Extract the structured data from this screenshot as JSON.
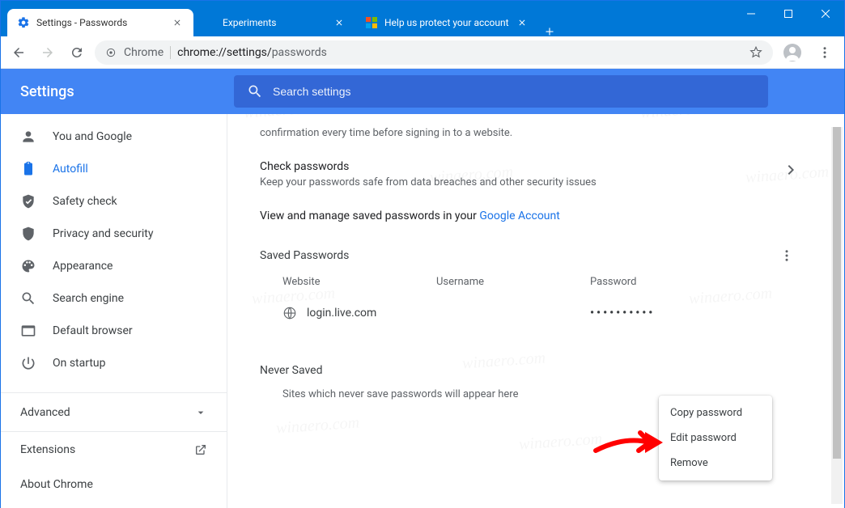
{
  "window": {
    "tabs": [
      {
        "title": "Settings - Passwords",
        "active": true
      },
      {
        "title": "Experiments",
        "active": false
      },
      {
        "title": "Help us protect your account",
        "active": false
      }
    ]
  },
  "omnibox": {
    "origin_label": "Chrome",
    "url_host": "chrome://settings/",
    "url_path": "passwords"
  },
  "header": {
    "brand": "Settings",
    "search_placeholder": "Search settings"
  },
  "sidebar": {
    "items": [
      {
        "label": "You and Google"
      },
      {
        "label": "Autofill"
      },
      {
        "label": "Safety check"
      },
      {
        "label": "Privacy and security"
      },
      {
        "label": "Appearance"
      },
      {
        "label": "Search engine"
      },
      {
        "label": "Default browser"
      },
      {
        "label": "On startup"
      }
    ],
    "advanced": "Advanced",
    "extensions": "Extensions",
    "about": "About Chrome"
  },
  "main": {
    "fingerprint_sub": "confirmation every time before signing in to a website.",
    "check": {
      "title": "Check passwords",
      "sub": "Keep your passwords safe from data breaches and other security issues"
    },
    "manage_prefix": "View and manage saved passwords in your ",
    "manage_link": "Google Account",
    "saved_title": "Saved Passwords",
    "cols": {
      "website": "Website",
      "username": "Username",
      "password": "Password"
    },
    "row": {
      "site": "login.live.com",
      "password_mask": "••••••••••"
    },
    "never_title": "Never Saved",
    "never_text": "Sites which never save passwords will appear here"
  },
  "menu": {
    "copy": "Copy password",
    "edit": "Edit password",
    "remove": "Remove"
  },
  "watermark": "winaero.com"
}
